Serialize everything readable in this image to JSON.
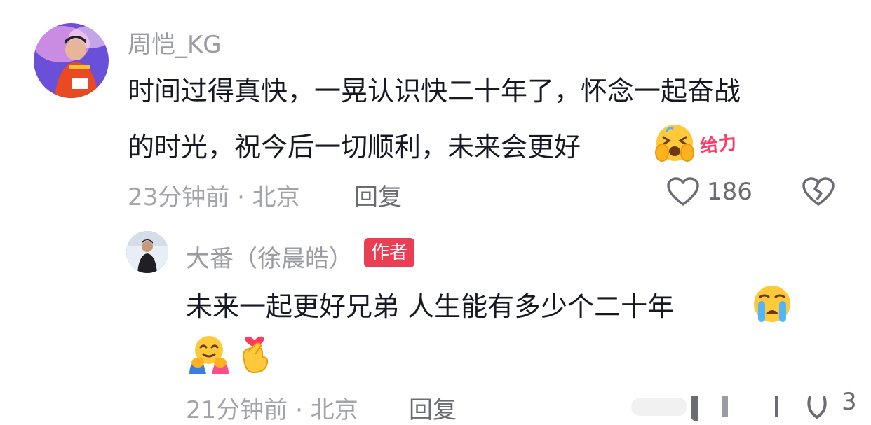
{
  "comment": {
    "username": "周恺_KG",
    "text_line1": "时间过得真快，一晃认识快二十年了，怀念一起奋战",
    "text_line2": "的时光，祝今后一切顺利，未来会更好",
    "sticker_text": "给力",
    "time_location": "23分钟前 · 北京",
    "reply_label": "回复",
    "like_count": "186",
    "icons": [
      "cry-laugh-emoji",
      "heart-outline-icon",
      "broken-heart-icon"
    ]
  },
  "reply": {
    "username": "大番（徐晨皓）",
    "author_badge": "作者",
    "text_line1": "未来一起更好兄弟 人生能有多少个二十年",
    "time_location": "21分钟前 · 北京",
    "reply_label": "回复",
    "like_count": "3",
    "icons": [
      "crying-emoji",
      "hug-emoji",
      "finger-heart-emoji"
    ]
  },
  "colors": {
    "text": "#161823",
    "meta": "#a3a4aa",
    "badge": "#ea3e55",
    "sticker": "#ff3a67"
  }
}
